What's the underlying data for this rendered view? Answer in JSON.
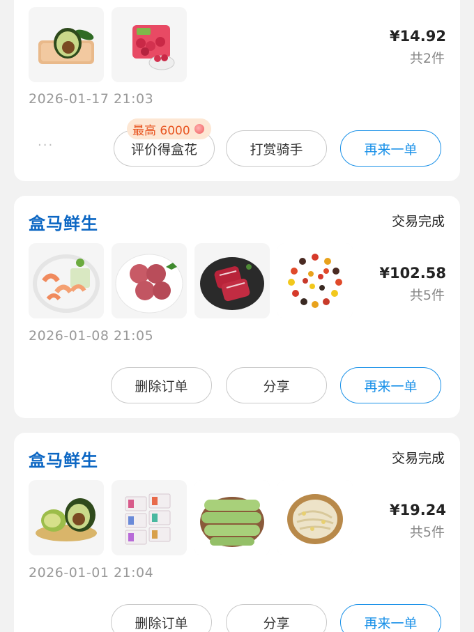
{
  "orders": [
    {
      "price": "¥14.92",
      "count": "共2件",
      "date": "2026-01-17 21:03",
      "more": "···",
      "badge": "最高 6000",
      "buttons": [
        "评价得盒花",
        "打赏骑手",
        "再来一单"
      ],
      "items": [
        "avocado-icon",
        "raspberry-icon"
      ]
    },
    {
      "brand": "盒马鲜生",
      "status": "交易完成",
      "price": "¥102.58",
      "count": "共5件",
      "date": "2026-01-08 21:05",
      "buttons": [
        "删除订单",
        "分享",
        "再来一单"
      ],
      "items": [
        "shrimp-icon",
        "meat-patty-icon",
        "steak-icon",
        "cherry-tomato-icon"
      ]
    },
    {
      "brand": "盒马鲜生",
      "status": "交易完成",
      "price": "¥19.24",
      "count": "共5件",
      "date": "2026-01-01 21:04",
      "buttons": [
        "删除订单",
        "分享",
        "再来一单"
      ],
      "items": [
        "avocado-slices-icon",
        "tofu-packs-icon",
        "cucumber-icon",
        "bean-sprout-icon"
      ]
    }
  ],
  "colors": {
    "brand": "#0b66c3",
    "accent": "#1890e8",
    "badge_text": "#e8541f",
    "badge_bg": "#fde7d4"
  }
}
